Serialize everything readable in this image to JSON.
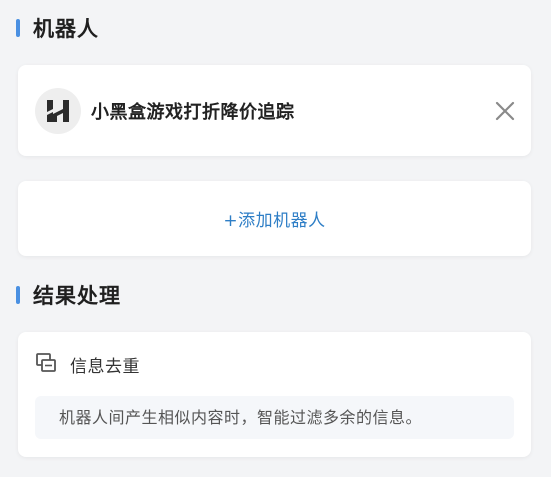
{
  "robots_section": {
    "title": "机器人"
  },
  "robot": {
    "name": "小黑盒游戏打折降价追踪",
    "logo_icon": "xiaoheihe-logo-icon",
    "remove_icon": "close-icon"
  },
  "add_robot": {
    "label": "+添加机器人"
  },
  "results_section": {
    "title": "结果处理"
  },
  "dedup": {
    "icon": "copy-icon",
    "title": "信息去重",
    "description": "机器人间产生相似内容时，智能过滤多余的信息。"
  },
  "colors": {
    "accent": "#4a90e2",
    "link": "#2e7ec6",
    "background": "#f3f4f6"
  }
}
